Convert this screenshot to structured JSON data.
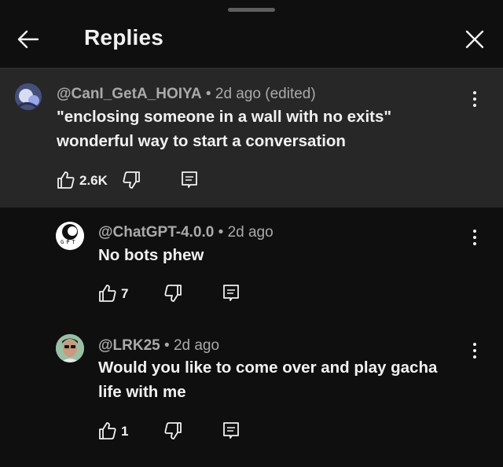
{
  "header": {
    "title": "Replies"
  },
  "parent_comment": {
    "author": "@CanI_GetA_HOIYA",
    "time": "2d ago (edited)",
    "text_lines": [
      "\"enclosing someone in a wall with no exits\"",
      "wonderful way to start a conversation"
    ],
    "likes": "2.6K"
  },
  "replies": [
    {
      "author": "@ChatGPT-4.0.0",
      "time": "2d ago",
      "text_lines": [
        "No bots phew"
      ],
      "likes": "7",
      "avatar_text": "GPT"
    },
    {
      "author": "@LRK25",
      "time": "2d ago",
      "text_lines": [
        "Would you like to come over and play gacha",
        "life with me"
      ],
      "likes": "1"
    }
  ],
  "separator": " • ",
  "icons": [
    "back-arrow-icon",
    "close-icon",
    "like-icon",
    "dislike-icon",
    "reply-icon",
    "more-vertical-icon"
  ]
}
